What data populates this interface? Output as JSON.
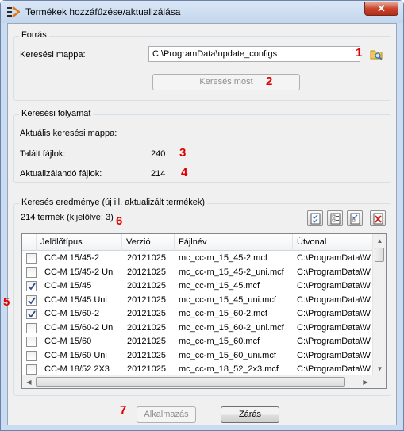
{
  "window": {
    "title": "Termékek hozzáfűzése/aktualizálása",
    "close_glyph": "✕"
  },
  "search_group": {
    "legend": "Forrás",
    "folder_label": "Keresési mappa:",
    "folder_value": "C:\\ProgramData\\update_configs",
    "search_button": "Keresés most"
  },
  "progress_group": {
    "legend": "Keresési folyamat",
    "current_folder_label": "Aktuális keresési mappa:",
    "found_label": "Talált fájlok:",
    "found_value": "240",
    "to_update_label": "Aktualizálandó fájlok:",
    "to_update_value": "214"
  },
  "results_group": {
    "legend": "Keresés eredménye (új ill. aktualizált termékek)",
    "count_text": "214 termék (kijelölve: 3)",
    "toolbar_icons": [
      "select-all-icon",
      "deselect-all-icon",
      "invert-selection-icon",
      "delete-icon"
    ],
    "columns": [
      "Jelölőtípus",
      "Verzió",
      "Fájlnév",
      "Útvonal"
    ],
    "rows": [
      {
        "checked": false,
        "type": "CC-M 15/45-2",
        "version": "20121025",
        "file": "mc_cc-m_15_45-2.mcf",
        "path": "C:\\ProgramData\\W"
      },
      {
        "checked": false,
        "type": "CC-M 15/45-2 Uni",
        "version": "20121025",
        "file": "mc_cc-m_15_45-2_uni.mcf",
        "path": "C:\\ProgramData\\W"
      },
      {
        "checked": true,
        "type": "CC-M 15/45",
        "version": "20121025",
        "file": "mc_cc-m_15_45.mcf",
        "path": "C:\\ProgramData\\W"
      },
      {
        "checked": true,
        "type": "CC-M 15/45 Uni",
        "version": "20121025",
        "file": "mc_cc-m_15_45_uni.mcf",
        "path": "C:\\ProgramData\\W"
      },
      {
        "checked": true,
        "type": "CC-M 15/60-2",
        "version": "20121025",
        "file": "mc_cc-m_15_60-2.mcf",
        "path": "C:\\ProgramData\\W"
      },
      {
        "checked": false,
        "type": "CC-M 15/60-2 Uni",
        "version": "20121025",
        "file": "mc_cc-m_15_60-2_uni.mcf",
        "path": "C:\\ProgramData\\W"
      },
      {
        "checked": false,
        "type": "CC-M 15/60",
        "version": "20121025",
        "file": "mc_cc-m_15_60.mcf",
        "path": "C:\\ProgramData\\W"
      },
      {
        "checked": false,
        "type": "CC-M 15/60 Uni",
        "version": "20121025",
        "file": "mc_cc-m_15_60_uni.mcf",
        "path": "C:\\ProgramData\\W"
      },
      {
        "checked": false,
        "type": "CC-M 18/52 2X3",
        "version": "20121025",
        "file": "mc_cc-m_18_52_2x3.mcf",
        "path": "C:\\ProgramData\\W"
      }
    ]
  },
  "buttons": {
    "apply": "Alkalmazás",
    "close": "Zárás"
  },
  "markers": [
    "1",
    "2",
    "3",
    "4",
    "5",
    "6",
    "7"
  ],
  "colors": {
    "marker": "#e00000",
    "title_bar": "#c9dcf2",
    "close_button": "#c7442b"
  }
}
